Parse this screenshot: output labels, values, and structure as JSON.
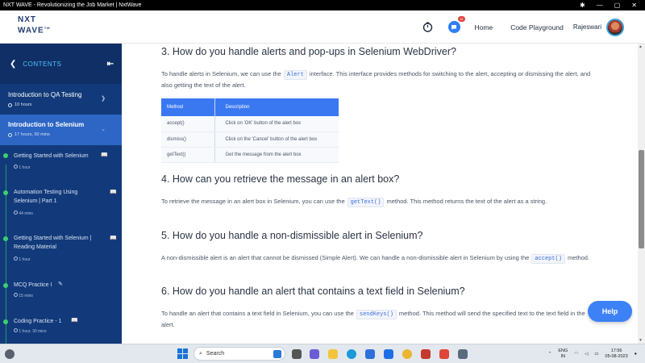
{
  "window": {
    "title": "NXT WAVE - Revolutionizing the Job Market | NxtWave"
  },
  "header": {
    "logo_line1": "NXT",
    "logo_line2": "WAVE",
    "logo_tm": "TM",
    "notification_count": "14",
    "nav": [
      {
        "label": "Home"
      },
      {
        "label": "Code Playground"
      }
    ],
    "user_name": "Rajeswari"
  },
  "sidebar": {
    "heading": "CONTENTS",
    "topics": [
      {
        "title": "Introduction to QA Testing",
        "meta": "10 hours"
      },
      {
        "title": "Introduction to Selenium",
        "meta": "17 hours, 50 mins"
      }
    ],
    "items": [
      {
        "title": "Getting Started with Selenium",
        "meta": "1 hour",
        "icon": "book-icon"
      },
      {
        "title": "Automation Testing Using Selenium | Part 1",
        "meta": "44 mins",
        "icon": "book-icon"
      },
      {
        "title": "Getting Started with Selenium | Reading Material",
        "meta": "1 hour",
        "icon": "book-icon"
      },
      {
        "title": "MCQ Practice I",
        "meta": "15 mins",
        "icon": "pencil-icon"
      },
      {
        "title": "Coding Practice - 1",
        "meta": "1 hour, 30 mins",
        "icon": "book-icon"
      }
    ]
  },
  "main": {
    "q3": {
      "heading": "3. How do you handle alerts and pop-ups in Selenium WebDriver?",
      "text_before": "To handle alerts in Selenium, we can use the",
      "code": "Alert",
      "text_after": "interface. This interface provides methods for switching to the alert, accepting or dismissing the alert, and also getting the text of the alert."
    },
    "table": {
      "headers": [
        "Method",
        "Description"
      ],
      "rows": [
        [
          "accept()",
          "Click on 'OK' button of the alert box"
        ],
        [
          "dismiss()",
          "Click on the 'Cancel' button of the alert box"
        ],
        [
          "getText()",
          "Get the message from the alert box"
        ]
      ]
    },
    "q4": {
      "heading": "4. How can you retrieve the message in an alert box?",
      "text_before": "To retrieve the message in an alert box in Selenium, you can use the",
      "code": "getText()",
      "text_after": "method. This method returns the text of the alert as a string."
    },
    "q5": {
      "heading": "5. How do you handle a non-dismissible alert in Selenium?",
      "text_before": "A non-dismissible alert is an alert that cannot be dismissed (Simple Alert). We can handle a non-dismissible alert in Selenium by using the",
      "code": "accept()",
      "text_after": "method."
    },
    "q6": {
      "heading": "6. How do you handle an alert that contains a text field in Selenium?",
      "text_before": "To handle an alert that contains a text field in Selenium, you can use the",
      "code": "sendKeys()",
      "text_after": "method. This method will send the specified text to the text field in the alert."
    }
  },
  "help_label": "Help",
  "taskbar": {
    "search_label": "Search",
    "lang_line1": "ENG",
    "lang_line2": "IN",
    "time": "17:56",
    "date": "05-08-2023"
  },
  "colors": {
    "sidebar_bg": "#123a7a",
    "active_topic": "#2d66c4",
    "accent": "#3a78f2",
    "complete_dot": "#3bd06f"
  }
}
